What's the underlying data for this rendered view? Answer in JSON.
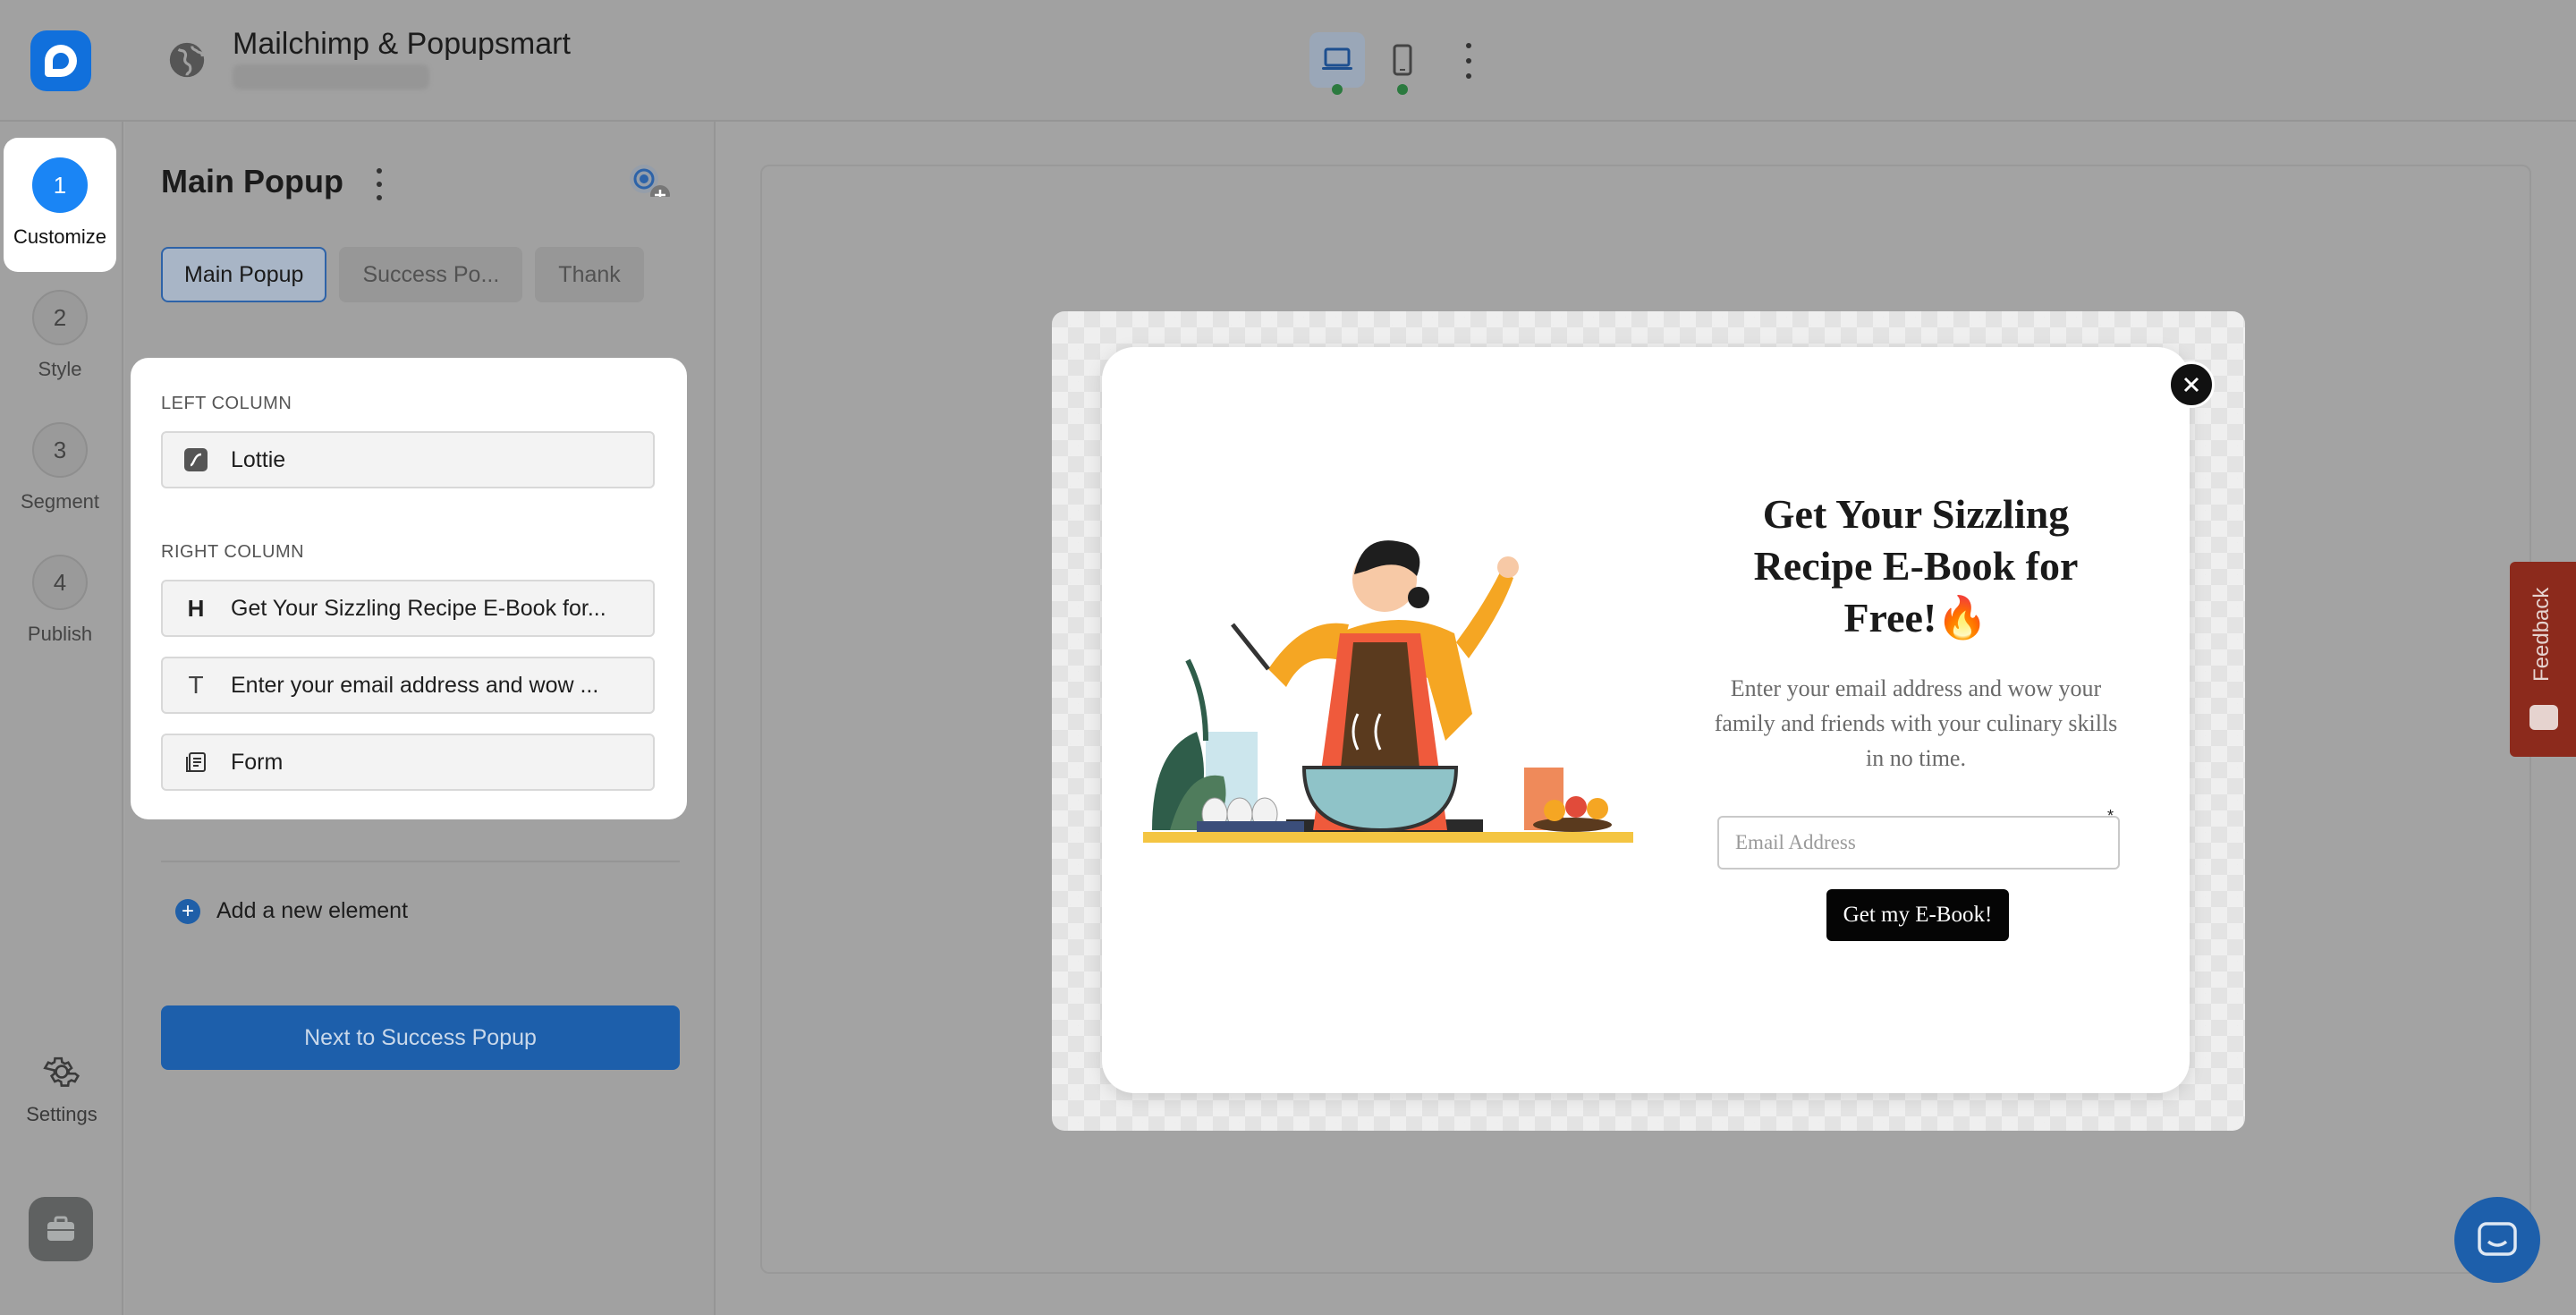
{
  "header": {
    "site_title": "Mailchimp & Popupsmart",
    "device_desktop": "desktop-icon",
    "device_mobile": "mobile-icon"
  },
  "steps": [
    {
      "number": "1",
      "label": "Customize",
      "active": true
    },
    {
      "number": "2",
      "label": "Style",
      "active": false
    },
    {
      "number": "3",
      "label": "Segment",
      "active": false
    },
    {
      "number": "4",
      "label": "Publish",
      "active": false
    }
  ],
  "rail": {
    "settings_label": "Settings"
  },
  "panel": {
    "title": "Main Popup",
    "tabs": [
      {
        "label": "Main Popup",
        "active": true
      },
      {
        "label": "Success Po...",
        "active": false
      },
      {
        "label": "Thank",
        "active": false
      }
    ],
    "left_column_label": "LEFT COLUMN",
    "right_column_label": "RIGHT COLUMN",
    "left_items": [
      {
        "icon": "lottie-icon",
        "label": "Lottie"
      }
    ],
    "right_items": [
      {
        "icon": "heading-icon",
        "label": "Get Your Sizzling Recipe E-Book for..."
      },
      {
        "icon": "text-icon",
        "label": "Enter your email address and wow ..."
      },
      {
        "icon": "form-icon",
        "label": "Form"
      }
    ],
    "add_element_label": "Add a new element",
    "next_button_label": "Next to Success Popup"
  },
  "popup": {
    "title": "Get Your Sizzling Recipe E-Book for Free!🔥",
    "text": "Enter your email address and wow your family and friends with your culinary skills in no time.",
    "email_placeholder": "Email Address",
    "cta_label": "Get my E-Book!"
  },
  "feedback_label": "Feedback",
  "colors": {
    "accent": "#1a85f5",
    "primary_button": "#1d5fab",
    "feedback": "#8c2a1c"
  }
}
